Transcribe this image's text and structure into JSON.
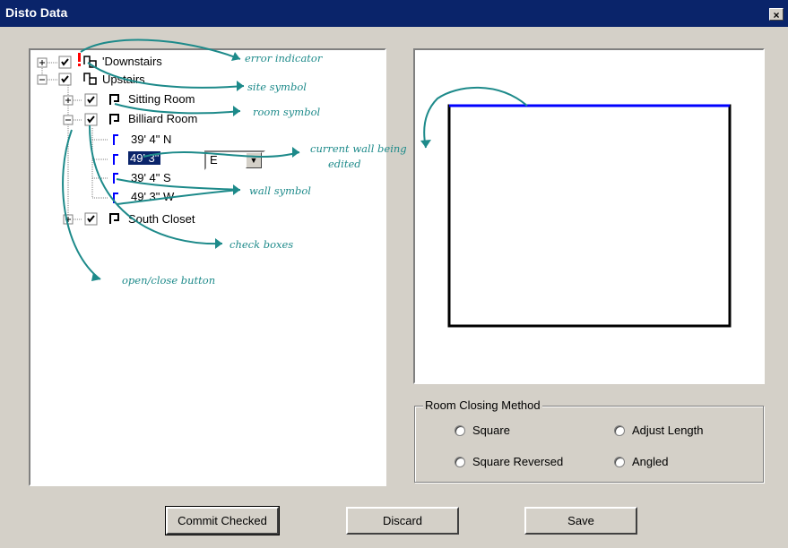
{
  "window": {
    "title": "Disto Data",
    "close_glyph": "×"
  },
  "tree": {
    "items": [
      {
        "label": "'Downstairs",
        "expander": "+",
        "checked": true,
        "icon": "site-icon",
        "error": true
      },
      {
        "label": "Upstairs",
        "expander": "−",
        "checked": true,
        "icon": "site-icon"
      },
      {
        "label": "Sitting Room",
        "expander": "+",
        "checked": true,
        "icon": "room-icon"
      },
      {
        "label": "Billiard Room",
        "expander": "−",
        "checked": true,
        "icon": "room-icon"
      },
      {
        "label": "39' 4\" N",
        "icon": "wall-icon"
      },
      {
        "label": "49' 3\"",
        "icon": "wall-icon",
        "selected": true
      },
      {
        "label": "39' 4\" S",
        "icon": "wall-icon"
      },
      {
        "label": "49' 3\" W",
        "icon": "wall-icon"
      },
      {
        "label": "South Closet",
        "expander": "+",
        "checked": true,
        "icon": "room-icon"
      }
    ],
    "combo_value": "E"
  },
  "annotations": {
    "error_indicator": "error indicator",
    "site_symbol": "site symbol",
    "room_symbol": "room symbol",
    "current_wall": "current wall being",
    "current_wall_2": "edited",
    "wall_symbol": "wall symbol",
    "check_boxes": "check boxes",
    "open_close": "open/close button"
  },
  "closing_method": {
    "label": "Room Closing Method",
    "options": [
      "Square",
      "Adjust Length",
      "Square Reversed",
      "Angled"
    ]
  },
  "buttons": {
    "commit": "Commit Checked",
    "discard": "Discard",
    "save": "Save"
  },
  "colors": {
    "title_bar": "#0a246a",
    "annotation": "#1d8a8a",
    "selected_wall": "#0000ff",
    "error": "#ff0000"
  }
}
